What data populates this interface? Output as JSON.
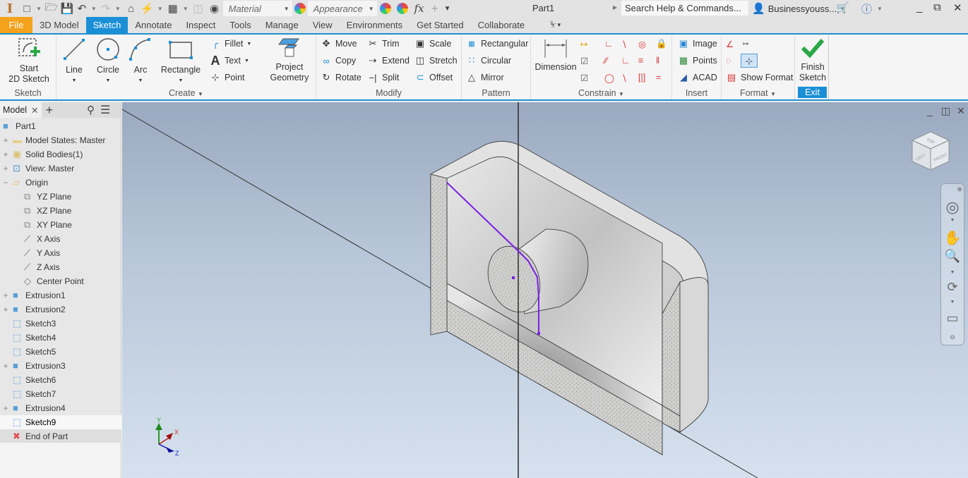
{
  "app": {
    "title": "Part1",
    "logo": "inventor-logo-icon"
  },
  "qat": {
    "material_placeholder": "Material",
    "appearance_placeholder": "Appearance",
    "search_placeholder": "Search Help & Commands...",
    "user": "Businessyouss...",
    "icons": [
      "new-icon",
      "open-icon",
      "save-icon",
      "undo-icon",
      "redo-icon",
      "home-icon",
      "update-icon",
      "select-icon",
      "material-icon",
      "appearance-icon",
      "fx-icon",
      "plus-icon"
    ]
  },
  "tabs": [
    {
      "label": "File"
    },
    {
      "label": "3D Model"
    },
    {
      "label": "Sketch",
      "active": true
    },
    {
      "label": "Annotate"
    },
    {
      "label": "Inspect"
    },
    {
      "label": "Tools"
    },
    {
      "label": "Manage"
    },
    {
      "label": "View"
    },
    {
      "label": "Environments"
    },
    {
      "label": "Get Started"
    },
    {
      "label": "Collaborate"
    }
  ],
  "ribbon": {
    "sketch_panel": {
      "title": "Sketch",
      "start_line1": "Start",
      "start_line2": "2D Sketch"
    },
    "create_panel": {
      "title": "Create",
      "line": "Line",
      "circle": "Circle",
      "arc": "Arc",
      "rectangle": "Rectangle",
      "fillet": "Fillet",
      "text": "Text",
      "point": "Point",
      "project_line1": "Project",
      "project_line2": "Geometry"
    },
    "modify_panel": {
      "title": "Modify",
      "move": "Move",
      "copy": "Copy",
      "rotate": "Rotate",
      "trim": "Trim",
      "extend": "Extend",
      "split": "Split",
      "scale": "Scale",
      "stretch": "Stretch",
      "offset": "Offset"
    },
    "pattern_panel": {
      "title": "Pattern",
      "rectangular": "Rectangular",
      "circular": "Circular",
      "mirror": "Mirror"
    },
    "constrain_panel": {
      "title": "Constrain",
      "dimension": "Dimension"
    },
    "insert_panel": {
      "title": "Insert",
      "image": "Image",
      "points": "Points",
      "acad": "ACAD"
    },
    "format_panel": {
      "title": "Format",
      "show_format": "Show Format"
    },
    "exit_panel": {
      "title": "Exit",
      "finish_line1": "Finish",
      "finish_line2": "Sketch"
    }
  },
  "browser": {
    "tab": "Model",
    "items": [
      {
        "label": "Part1",
        "icon": "part-icon",
        "level": 0
      },
      {
        "label": "Model States: Master",
        "icon": "folder-icon",
        "level": 0,
        "exp": "+"
      },
      {
        "label": "Solid Bodies(1)",
        "icon": "solid-bodies-icon",
        "level": 0,
        "exp": "+"
      },
      {
        "label": "View: Master",
        "icon": "view-icon",
        "level": 0,
        "exp": "+"
      },
      {
        "label": "Origin",
        "icon": "folder-open-icon",
        "level": 0,
        "exp": "−"
      },
      {
        "label": "YZ Plane",
        "icon": "plane-icon",
        "level": 1
      },
      {
        "label": "XZ Plane",
        "icon": "plane-icon",
        "level": 1
      },
      {
        "label": "XY Plane",
        "icon": "plane-icon",
        "level": 1
      },
      {
        "label": "X Axis",
        "icon": "axis-icon",
        "level": 1
      },
      {
        "label": "Y Axis",
        "icon": "axis-icon",
        "level": 1
      },
      {
        "label": "Z Axis",
        "icon": "axis-icon",
        "level": 1
      },
      {
        "label": "Center Point",
        "icon": "point-icon",
        "level": 1
      },
      {
        "label": "Extrusion1",
        "icon": "extrusion-icon",
        "level": 0,
        "exp": "+"
      },
      {
        "label": "Extrusion2",
        "icon": "extrusion-icon",
        "level": 0,
        "exp": "+"
      },
      {
        "label": "Sketch3",
        "icon": "sketch-icon",
        "level": 0
      },
      {
        "label": "Sketch4",
        "icon": "sketch-icon",
        "level": 0
      },
      {
        "label": "Sketch5",
        "icon": "sketch-icon",
        "level": 0
      },
      {
        "label": "Extrusion3",
        "icon": "extrusion-icon",
        "level": 0,
        "exp": "+"
      },
      {
        "label": "Sketch6",
        "icon": "sketch-icon",
        "level": 0
      },
      {
        "label": "Sketch7",
        "icon": "sketch-icon",
        "level": 0
      },
      {
        "label": "Extrusion4",
        "icon": "extrusion-icon",
        "level": 0,
        "exp": "+"
      },
      {
        "label": "Sketch9",
        "icon": "sketch-icon",
        "level": 0,
        "selected": true
      },
      {
        "label": "End of Part",
        "icon": "end-of-part-icon",
        "level": 0
      }
    ]
  },
  "viewcube": {
    "top": "TOP",
    "left": "LEFT",
    "front": "FRONT"
  },
  "triad": {
    "x": "X",
    "y": "Y",
    "z": "Z"
  },
  "colors": {
    "accent": "#1a8fd6",
    "file_tab": "#f4a21b",
    "sketch_line": "#7a1fe6",
    "finish_green": "#2aa847"
  }
}
